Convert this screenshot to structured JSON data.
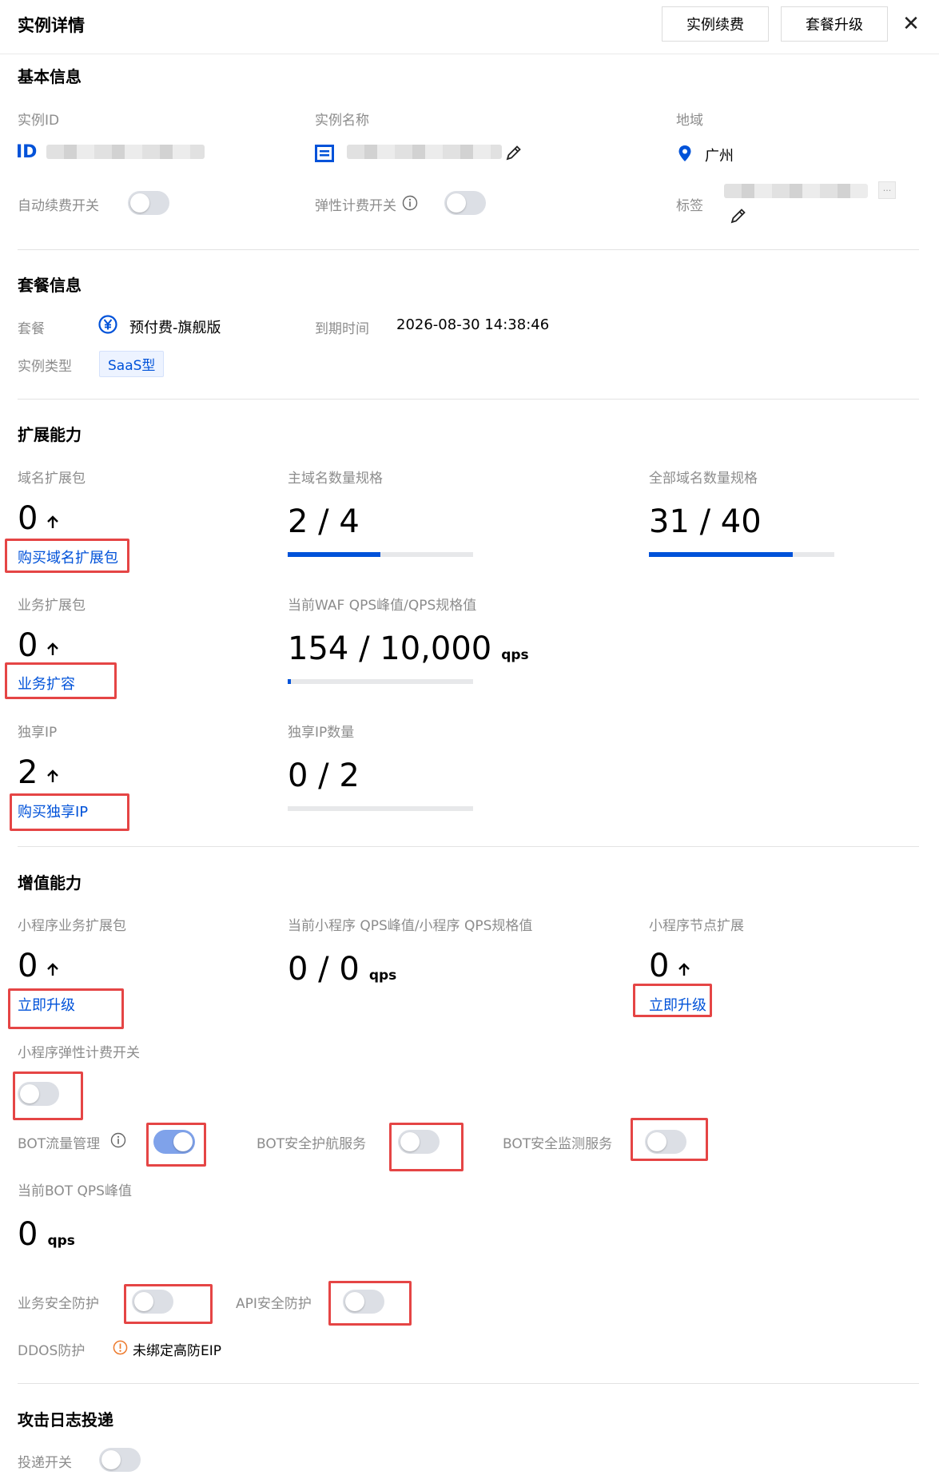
{
  "header": {
    "title": "实例详情",
    "renew_label": "实例续费",
    "upgrade_label": "套餐升级",
    "close_symbol": "✕"
  },
  "basic": {
    "title": "基本信息",
    "instance_id_label": "实例ID",
    "instance_id_icon_text": "ID",
    "instance_name_label": "实例名称",
    "region_label": "地域",
    "region_value": "广州",
    "auto_renew_label": "自动续费开关",
    "elastic_billing_label": "弹性计费开关",
    "tag_label": "标签",
    "ellipsis": "..."
  },
  "package": {
    "title": "套餐信息",
    "plan_label": "套餐",
    "plan_value": "预付费-旗舰版",
    "expire_label": "到期时间",
    "expire_value": "2026-08-30 14:38:46",
    "type_label": "实例类型",
    "type_value": "SaaS型"
  },
  "expansion": {
    "title": "扩展能力",
    "domain_pack_label": "域名扩展包",
    "domain_pack_value": "0",
    "domain_pack_link": "购买域名扩展包",
    "main_domain_label": "主域名数量规格",
    "main_domain_value": "2 / 4",
    "main_domain_progress": 0.5,
    "all_domain_label": "全部域名数量规格",
    "all_domain_value": "31 / 40",
    "all_domain_progress": 0.775,
    "biz_pack_label": "业务扩展包",
    "biz_pack_value": "0",
    "biz_pack_link": "业务扩容",
    "qps_label": "当前WAF QPS峰值/QPS规格值",
    "qps_value": "154 / 10,000",
    "qps_unit": "qps",
    "qps_progress": 0.0154,
    "exclusive_ip_label": "独享IP",
    "exclusive_ip_value": "2",
    "exclusive_ip_link": "购买独享IP",
    "exclusive_ip_count_label": "独享IP数量",
    "exclusive_ip_count_value": "0 / 2",
    "exclusive_ip_count_progress": 0
  },
  "value_added": {
    "title": "增值能力",
    "mini_pack_label": "小程序业务扩展包",
    "mini_pack_value": "0",
    "mini_pack_link": "立即升级",
    "mini_qps_label": "当前小程序 QPS峰值/小程序 QPS规格值",
    "mini_qps_value": "0 / 0",
    "mini_qps_unit": "qps",
    "mini_node_label": "小程序节点扩展",
    "mini_node_value": "0",
    "mini_node_link": "立即升级",
    "mini_elastic_label": "小程序弹性计费开关",
    "bot_traffic_label": "BOT流量管理",
    "bot_escort_label": "BOT安全护航服务",
    "bot_monitor_label": "BOT安全监测服务",
    "bot_qps_label": "当前BOT QPS峰值",
    "bot_qps_value": "0",
    "bot_qps_unit": "qps",
    "biz_security_label": "业务安全防护",
    "api_security_label": "API安全防护",
    "ddos_label": "DDOS防护",
    "ddos_value": "未绑定高防EIP"
  },
  "attack_log": {
    "title": "攻击日志投递",
    "delivery_label": "投递开关"
  },
  "colors": {
    "accent": "#0052d9",
    "warning": "#ed7b2f",
    "highlight": "#e54545"
  }
}
